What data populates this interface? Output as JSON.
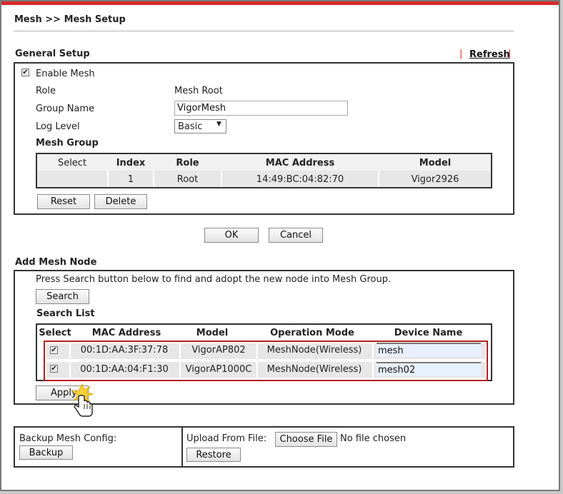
{
  "breadcrumb": "Mesh >> Mesh Setup",
  "general": {
    "section_title": "General Setup",
    "refresh_label": "Refresh",
    "pipe_left": "|",
    "pipe_right": "|",
    "enable_mesh_label": "Enable Mesh",
    "enable_mesh_checked": true,
    "role_label": "Role",
    "role_value": "Mesh Root",
    "group_name_label": "Group Name",
    "group_name_value": "VigorMesh",
    "log_level_label": "Log Level",
    "log_level_value": "Basic",
    "mesh_group_title": "Mesh Group",
    "table_headers": [
      "Select",
      "Index",
      "Role",
      "MAC Address",
      "Model"
    ],
    "rows": [
      {
        "index": "1",
        "role": "Root",
        "mac": "14:49:BC:04:82:70",
        "model": "Vigor2926"
      }
    ],
    "reset_label": "Reset",
    "delete_label": "Delete"
  },
  "ok_label": "OK",
  "cancel_label": "Cancel",
  "add_node": {
    "section_title": "Add Mesh Node",
    "instruction": "Press Search button below to find and adopt the new node into Mesh Group.",
    "search_label": "Search",
    "search_list_title": "Search List",
    "table_headers": [
      "Select",
      "MAC Address",
      "Model",
      "Operation Mode",
      "Device Name"
    ],
    "rows": [
      {
        "checked": true,
        "mac": "00:1D:AA:3F:37:78",
        "model": "VigorAP802",
        "mode": "MeshNode(Wireless)",
        "name": "mesh"
      },
      {
        "checked": true,
        "mac": "00:1D:AA:04:F1:30",
        "model": "VigorAP1000C",
        "mode": "MeshNode(Wireless)",
        "name": "mesh02"
      }
    ],
    "apply_label": "Apply"
  },
  "backup": {
    "label": "Backup Mesh Config:",
    "backup_button": "Backup",
    "upload_label": "Upload From File:",
    "choose_file_button": "Choose File",
    "file_status": "No file chosen",
    "restore_button": "Restore"
  },
  "colors": {
    "accent_red": "#d92a2a",
    "highlight_border": "#b42020",
    "header_row_bg": "#f0f0f0",
    "data_row_bg": "#e6e6e6",
    "input_highlight_bg": "#e8f0fd"
  }
}
